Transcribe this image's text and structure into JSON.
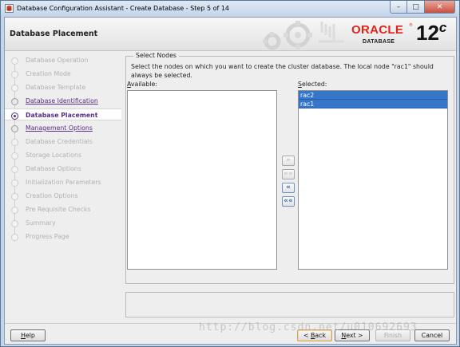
{
  "window": {
    "title": "Database Configuration Assistant - Create Database - Step 5 of 14",
    "controls": {
      "minimize": "–",
      "maximize": "□",
      "close": "✕"
    }
  },
  "header": {
    "title": "Database Placement",
    "logo": {
      "brand": "ORACLE",
      "product": "DATABASE",
      "version": "12",
      "version_suffix": "c",
      "registered": "®"
    }
  },
  "steps": [
    {
      "label": "Database Operation",
      "state": "disabled"
    },
    {
      "label": "Creation Mode",
      "state": "disabled"
    },
    {
      "label": "Database Template",
      "state": "disabled"
    },
    {
      "label": "Database Identification",
      "state": "link"
    },
    {
      "label": "Database Placement",
      "state": "current"
    },
    {
      "label": "Management Options",
      "state": "link"
    },
    {
      "label": "Database Credentials",
      "state": "disabled"
    },
    {
      "label": "Storage Locations",
      "state": "disabled"
    },
    {
      "label": "Database Options",
      "state": "disabled"
    },
    {
      "label": "Initialization Parameters",
      "state": "disabled"
    },
    {
      "label": "Creation Options",
      "state": "disabled"
    },
    {
      "label": "Pre Requisite Checks",
      "state": "disabled"
    },
    {
      "label": "Summary",
      "state": "disabled"
    },
    {
      "label": "Progress Page",
      "state": "disabled"
    }
  ],
  "select_nodes": {
    "legend": "Select Nodes",
    "instruction": "Select the nodes on which you want to create the cluster database. The local node \"rac1\" should always be selected.",
    "available_label_mnemonic": "A",
    "available_label_rest": "vailable:",
    "available_items": [],
    "selected_label_mnemonic": "S",
    "selected_label_rest": "elected:",
    "selected_items": [
      "rac2",
      "rac1"
    ]
  },
  "movers": [
    {
      "name": "move-right-button",
      "glyph": "»",
      "enabled": false
    },
    {
      "name": "move-all-right-button",
      "glyph": "»»",
      "enabled": false
    },
    {
      "name": "move-left-button",
      "glyph": "«",
      "enabled": true
    },
    {
      "name": "move-all-left-button",
      "glyph": "««",
      "enabled": true
    }
  ],
  "footer": {
    "help_mnemonic": "H",
    "help_rest": "elp",
    "back_prefix": "< ",
    "back_mnemonic": "B",
    "back_rest": "ack",
    "next_mnemonic": "N",
    "next_rest": "ext >",
    "finish_label": "Finish",
    "cancel_label": "Cancel"
  },
  "watermark": "http://blog.csdn.net/u010692693"
}
